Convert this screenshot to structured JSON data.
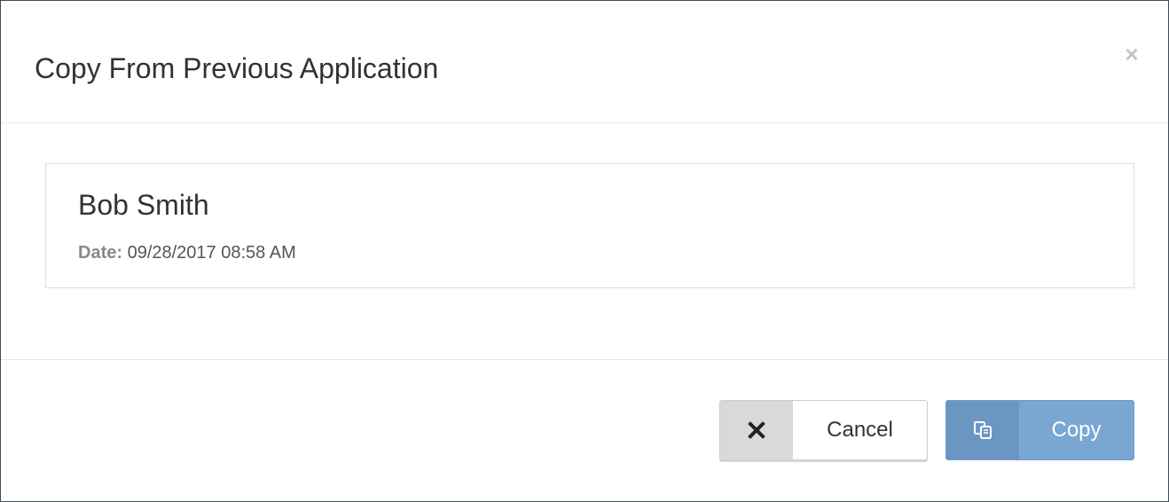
{
  "modal": {
    "title": "Copy From Previous Application",
    "close_label": "×"
  },
  "applications": [
    {
      "name": "Bob Smith",
      "date_label": "Date:",
      "date_value": "09/28/2017 08:58 AM"
    }
  ],
  "footer": {
    "cancel_label": "Cancel",
    "cancel_icon": "times-icon",
    "copy_label": "Copy",
    "copy_icon": "copy-icon"
  },
  "colors": {
    "primary": "#7aa6d2",
    "primary_dark": "#6b96c2",
    "cancel_icon_bg": "#d9d9d9",
    "text": "#333333"
  }
}
